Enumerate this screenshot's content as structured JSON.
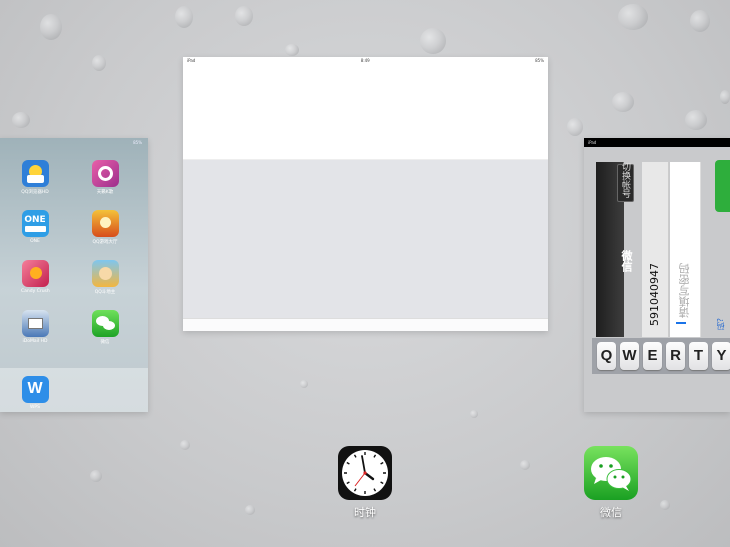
{
  "home_card": {
    "status_right": "85%",
    "apps": [
      {
        "name": "QQ浏览器HD",
        "color": "#2f7fd8"
      },
      {
        "name": "天籁K歌",
        "color": "#c93a9c"
      },
      {
        "name": "ONE",
        "color": "#2f9ee6"
      },
      {
        "name": "QQ游戏大厅",
        "color": "#e0741c"
      },
      {
        "name": "Candy Crush",
        "color": "#e03d62"
      },
      {
        "name": "QQ斗地主",
        "color": "#f2b640"
      },
      {
        "name": "iDoMail HD",
        "color": "#4a78b7"
      },
      {
        "name": "微信",
        "color": "#2dbf3a"
      }
    ],
    "dock_app": {
      "name": "WPS",
      "color": "#2e8ee8"
    }
  },
  "clock_card": {
    "status_left": "iPad",
    "status_center": "8:49",
    "status_right": "85%"
  },
  "wechat_card": {
    "status_left": "iPad",
    "switch_account": "切换帐号",
    "title": "微信",
    "account": "591040947",
    "password_placeholder": "请填写密码",
    "forgot_snip": "码?",
    "keys": [
      "Q",
      "W",
      "E",
      "R",
      "T",
      "Y"
    ]
  },
  "dock": {
    "clock_label": "时钟",
    "wechat_label": "微信"
  }
}
